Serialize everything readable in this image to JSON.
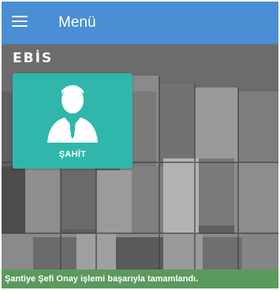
{
  "header": {
    "menu_icon": "hamburger-icon",
    "title": "Menü"
  },
  "brand": {
    "logo_text": "EBİS"
  },
  "tiles": [
    {
      "label": "ŞAHİT",
      "icon": "user-avatar-icon"
    }
  ],
  "notification": {
    "message": "Şantiye Şefi Onay işlemi başarıyla tamamlandı."
  },
  "colors": {
    "appbar": "#4a8ed3",
    "tile": "#2fb7ab",
    "notification": "#5b9a5d"
  }
}
